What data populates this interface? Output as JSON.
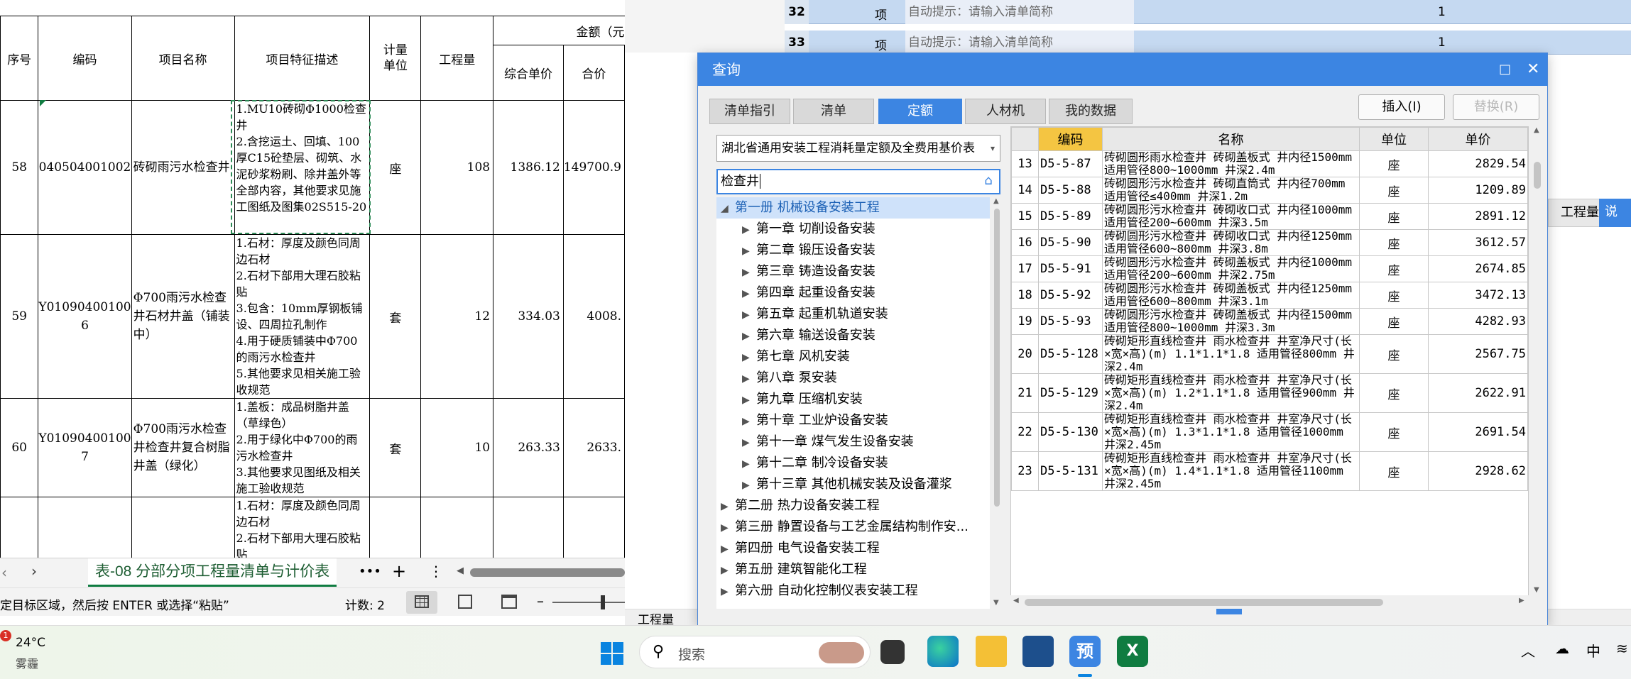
{
  "excel": {
    "amount_header": "金额（元",
    "headers": {
      "seq": "序号",
      "code": "编码",
      "name": "项目名称",
      "feature": "项目特征描述",
      "unit": "计量\n单位",
      "qty": "工程量",
      "unit_price": "综合单价",
      "total": "合价"
    },
    "rows": [
      {
        "seq": "58",
        "code": "040504001002",
        "name": "砖砌雨污水检查井",
        "feature": "1.MU10砖砌Φ1000检查井\n2.含挖运土、回填、100厚C15砼垫层、砌筑、水泥砂浆粉刷、除井盖外等全部内容，其他要求见施工图纸及图集02S515-20",
        "unit": "座",
        "qty": "108",
        "unit_price": "1386.12",
        "total": "149700.9"
      },
      {
        "seq": "59",
        "code": "Y01090400100\n6",
        "name": "Φ700雨污水检查井石材井盖（铺装中）",
        "feature": "1.石材：厚度及颜色同周边石材\n2.石材下部用大理石胶粘贴\n3.包含：10mm厚钢板铺设、四周拉孔制作\n4.用于硬质铺装中Φ700的雨污水检查井\n5.其他要求见相关施工验收规范",
        "unit": "套",
        "qty": "12",
        "unit_price": "334.03",
        "total": "4008."
      },
      {
        "seq": "60",
        "code": "Y01090400100\n7",
        "name": "Φ700雨污水检查井检查井复合树脂井盖（绿化）",
        "feature": "1.盖板：成品树脂井盖（草绿色）\n2.用于绿化中Φ700的雨污水检查井\n3.其他要求见图纸及相关施工验收规范",
        "unit": "套",
        "qty": "10",
        "unit_price": "263.33",
        "total": "2633."
      },
      {
        "seq": "",
        "code": "",
        "name": "",
        "feature": "1.石材：厚度及颜色同周边石材\n2.石材下部用大理石胶粘贴",
        "unit": "",
        "qty": "",
        "unit_price": "",
        "total": ""
      }
    ],
    "sheet_tab": "表-08 分部分项工程量清单与计价表",
    "more": "•••",
    "add": "+",
    "status_text": "定目标区域，然后按 ENTER 或选择“粘贴”",
    "count": "计数: 2"
  },
  "bg_app": {
    "rows": [
      {
        "num": "32",
        "unit": "项",
        "hint": "自动提示：请输入清单简称",
        "qty": "1"
      },
      {
        "num": "33",
        "unit": "项",
        "hint": "自动提示：请输入清单简称",
        "qty": "1"
      }
    ],
    "right_btn1": "工程量",
    "right_btn2": "说",
    "bottom_label": "工程量"
  },
  "dialog": {
    "title": "查询",
    "tabs": [
      "清单指引",
      "清单",
      "定额",
      "人材机",
      "我的数据"
    ],
    "active_tab": 2,
    "insert_btn": "插入(I)",
    "replace_btn": "替换(R)",
    "combo_value": "湖北省通用安装工程消耗量定额及全费用基价表",
    "search_value": "检查井",
    "tree": [
      {
        "label": "第一册 机械设备安装工程",
        "level": 0,
        "expanded": true,
        "selected": true
      },
      {
        "label": "第一章 切削设备安装",
        "level": 1
      },
      {
        "label": "第二章 锻压设备安装",
        "level": 1
      },
      {
        "label": "第三章 铸造设备安装",
        "level": 1
      },
      {
        "label": "第四章 起重设备安装",
        "level": 1
      },
      {
        "label": "第五章 起重机轨道安装",
        "level": 1
      },
      {
        "label": "第六章 输送设备安装",
        "level": 1
      },
      {
        "label": "第七章 风机安装",
        "level": 1
      },
      {
        "label": "第八章 泵安装",
        "level": 1
      },
      {
        "label": "第九章 压缩机安装",
        "level": 1
      },
      {
        "label": "第十章 工业炉设备安装",
        "level": 1
      },
      {
        "label": "第十一章 煤气发生设备安装",
        "level": 1
      },
      {
        "label": "第十二章 制冷设备安装",
        "level": 1
      },
      {
        "label": "第十三章 其他机械安装及设备灌浆",
        "level": 1
      },
      {
        "label": "第二册 热力设备安装工程",
        "level": 0
      },
      {
        "label": "第三册 静置设备与工艺金属结构制作安...",
        "level": 0
      },
      {
        "label": "第四册 电气设备安装工程",
        "level": 0
      },
      {
        "label": "第五册 建筑智能化工程",
        "level": 0
      },
      {
        "label": "第六册 自动化控制仪表安装工程",
        "level": 0
      }
    ],
    "table_headers": {
      "code": "编码",
      "name": "名称",
      "unit": "单位",
      "price": "单价"
    },
    "table_rows": [
      {
        "no": "13",
        "code": "D5-5-87",
        "name": "砖砌圆形雨水检查井 砖砌盖板式 井内径1500mm 适用管径800~1000mm 井深2.4m",
        "unit": "座",
        "price": "2829.54"
      },
      {
        "no": "14",
        "code": "D5-5-88",
        "name": "砖砌圆形污水检查井 砖砌直筒式 井内径700mm 适用管径≤400mm 井深1.2m",
        "unit": "座",
        "price": "1209.89"
      },
      {
        "no": "15",
        "code": "D5-5-89",
        "name": "砖砌圆形污水检查井 砖砌收口式 井内径1000mm 适用管径200~600mm 井深3.5m",
        "unit": "座",
        "price": "2891.12"
      },
      {
        "no": "16",
        "code": "D5-5-90",
        "name": "砖砌圆形污水检查井 砖砌收口式 井内径1250mm 适用管径600~800mm 井深3.8m",
        "unit": "座",
        "price": "3612.57"
      },
      {
        "no": "17",
        "code": "D5-5-91",
        "name": "砖砌圆形污水检查井 砖砌盖板式 井内径1000mm 适用管径200~600mm 井深2.75m",
        "unit": "座",
        "price": "2674.85"
      },
      {
        "no": "18",
        "code": "D5-5-92",
        "name": "砖砌圆形污水检查井 砖砌盖板式 井内径1250mm 适用管径600~800mm 井深3.1m",
        "unit": "座",
        "price": "3472.13"
      },
      {
        "no": "19",
        "code": "D5-5-93",
        "name": "砖砌圆形污水检查井 砖砌盖板式 井内径1500mm 适用管径800~1000mm 井深3.3m",
        "unit": "座",
        "price": "4282.93"
      },
      {
        "no": "20",
        "code": "D5-5-128",
        "name": "砖砌矩形直线检查井 雨水检查井 井室净尺寸(长×宽×高)(m) 1.1*1.1*1.8 适用管径800mm 井深2.4m",
        "unit": "座",
        "price": "2567.75"
      },
      {
        "no": "21",
        "code": "D5-5-129",
        "name": "砖砌矩形直线检查井 雨水检查井 井室净尺寸(长×宽×高)(m) 1.2*1.1*1.8 适用管径900mm 井深2.4m",
        "unit": "座",
        "price": "2622.91"
      },
      {
        "no": "22",
        "code": "D5-5-130",
        "name": "砖砌矩形直线检查井 雨水检查井 井室净尺寸(长×宽×高)(m) 1.3*1.1*1.8 适用管径1000mm 井深2.45m",
        "unit": "座",
        "price": "2691.54"
      },
      {
        "no": "23",
        "code": "D5-5-131",
        "name": "砖砌矩形直线检查井 雨水检查井 井室净尺寸(长×宽×高)(m) 1.4*1.1*1.8 适用管径1100mm 井深2.45m",
        "unit": "座",
        "price": "2928.62"
      }
    ]
  },
  "taskbar": {
    "weather_temp": "24°C",
    "weather_desc": "雾霾",
    "weather_badge": "1",
    "search_placeholder": "搜索",
    "tray_lang": "中",
    "accent_color": "#3c85e2"
  }
}
